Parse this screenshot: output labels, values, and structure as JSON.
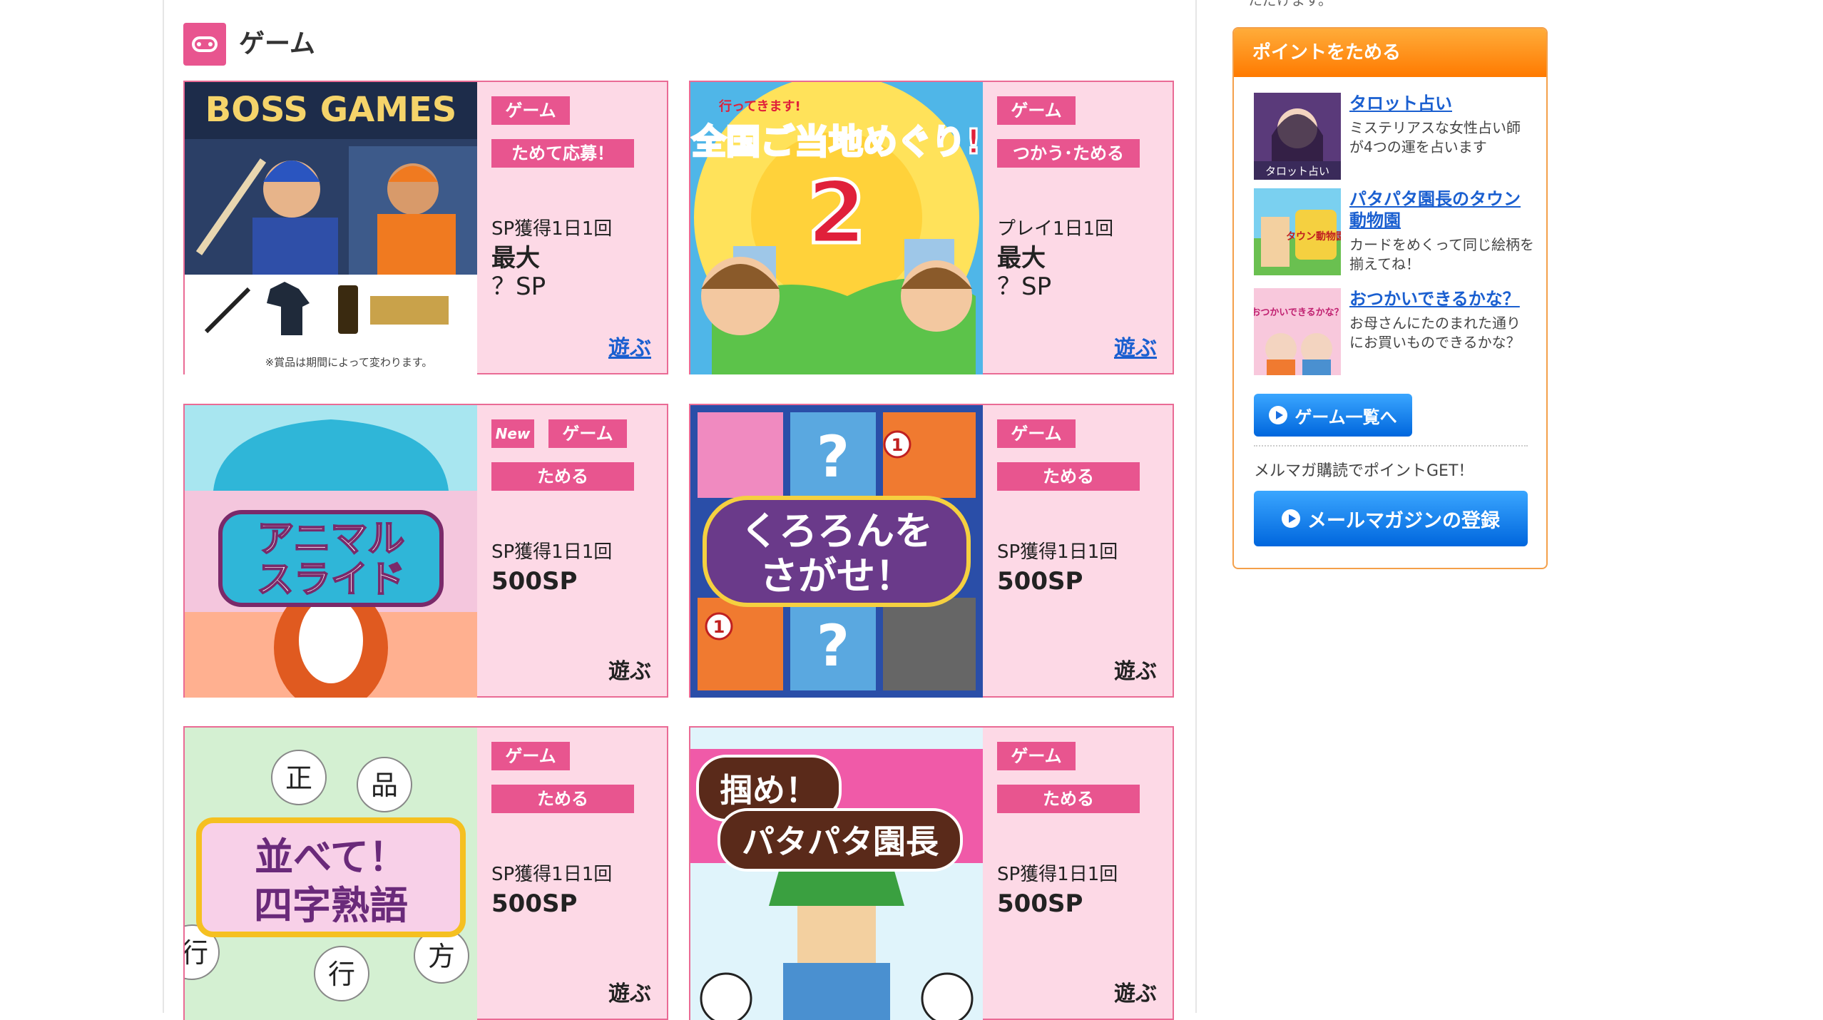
{
  "section": {
    "title": "ゲーム"
  },
  "top_note": "ただけます。",
  "cards": [
    {
      "genre": "ゲーム",
      "action": "ためて応募！",
      "info": "SP獲得1日1回",
      "big1": "最大",
      "big2": "？SP",
      "play": "遊ぶ",
      "new": "",
      "art": {
        "heading": "BOSS GAMES",
        "footnote": "※賞品は期間によって変わります。"
      }
    },
    {
      "genre": "ゲーム",
      "action": "つかう･ためる",
      "info": "プレイ1日1回",
      "big1": "最大",
      "big2": "？SP",
      "play": "遊ぶ",
      "new": "",
      "art": {
        "heading": "全国ご当地めぐり!",
        "number": "2",
        "sub": "行ってきます!"
      }
    },
    {
      "genre": "ゲーム",
      "action": "ためる",
      "info": "SP獲得1日1回",
      "big1": "500SP",
      "big2": "",
      "play": "遊ぶ",
      "new": "New",
      "art": {
        "line1": "アニマル",
        "line2": "スライド"
      }
    },
    {
      "genre": "ゲーム",
      "action": "ためる",
      "info": "SP獲得1日1回",
      "big1": "500SP",
      "big2": "",
      "play": "遊ぶ",
      "new": "",
      "art": {
        "line1": "くろろんを",
        "line2": "さがせ！",
        "q": "?",
        "one": "1"
      }
    },
    {
      "genre": "ゲーム",
      "action": "ためる",
      "info": "SP獲得1日1回",
      "big1": "500SP",
      "big2": "",
      "play": "遊ぶ",
      "new": "",
      "art": {
        "line1": "並べて！",
        "line2": "四字熟語",
        "k1": "正",
        "k2": "品",
        "k3": "行",
        "k4": "方",
        "k5": "行"
      }
    },
    {
      "genre": "ゲーム",
      "action": "ためる",
      "info": "SP獲得1日1回",
      "big1": "500SP",
      "big2": "",
      "play": "遊ぶ",
      "new": "",
      "art": {
        "line1": "掴め！",
        "line2": "パタパタ園長"
      }
    }
  ],
  "sidebar": {
    "header": "ポイントをためる",
    "items": [
      {
        "title": "タロット占い",
        "desc1": "ミステリアスな女性占い師",
        "desc2": "が4つの運を占います",
        "thumb_text": "タロット占い"
      },
      {
        "title": "パタパタ園長のタウン",
        "title2": "動物園",
        "desc1": "カードをめくって同じ絵柄を",
        "desc2": "揃えてね！",
        "thumb_text": "タウン動物園"
      },
      {
        "title": "おつかいできるかな？",
        "desc1": "お母さんにたのまれた通り",
        "desc2": "にお買いものできるかな？",
        "thumb_text": "おつかいできるかな？"
      }
    ],
    "games_button": "ゲーム一覧へ",
    "mail_note": "メルマガ購読でポイントGET！",
    "mail_button": "メールマガジンの登録"
  },
  "colors": {
    "pink": "#e8558f",
    "card_bg": "#fdd9e6",
    "orange": "#ff8a00",
    "blue": "#1a6fe0"
  }
}
